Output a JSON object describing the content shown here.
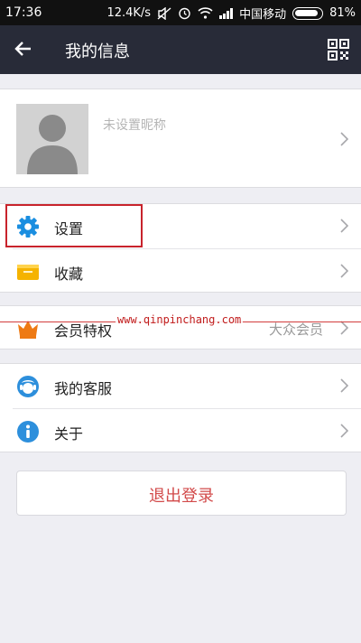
{
  "status_bar": {
    "time": "17:36",
    "speed": "12.4K/s",
    "carrier": "中国移动",
    "battery": "81%"
  },
  "header": {
    "title": "我的信息",
    "back_icon": "arrow-left-icon",
    "qr_icon": "qr-code-icon"
  },
  "profile": {
    "nickname": "未设置昵称",
    "avatar_icon": "default-avatar-icon"
  },
  "menu": {
    "settings": "设置",
    "favorites": "收藏",
    "membership": "会员特权",
    "membership_level": "大众会员",
    "customer_service": "我的客服",
    "about": "关于"
  },
  "logout_label": "退出登录",
  "watermark": "www.qinpinchang.com",
  "colors": {
    "header_bg": "#282b38",
    "accent_blue": "#1a8ee0",
    "favorites_yellow": "#f5b300",
    "crown_orange": "#ee7a14",
    "logout_red": "#d24a4a",
    "highlight_red": "#c8232c"
  }
}
